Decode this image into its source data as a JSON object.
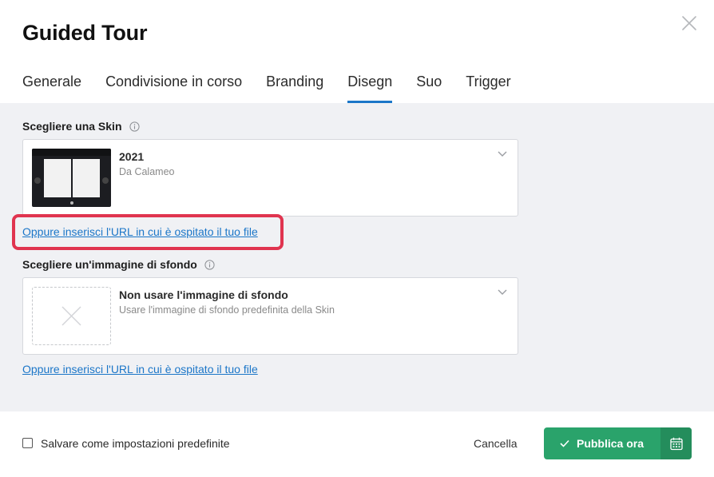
{
  "dialog": {
    "title": "Guided Tour"
  },
  "tabs": [
    {
      "label": "Generale",
      "active": false
    },
    {
      "label": "Condivisione in corso",
      "active": false
    },
    {
      "label": "Branding",
      "active": false
    },
    {
      "label": "Disegn",
      "active": true
    },
    {
      "label": "Suo",
      "active": false
    },
    {
      "label": "Trigger",
      "active": false
    }
  ],
  "skin": {
    "label": "Scegliere una Skin",
    "selected_title": "2021",
    "selected_subtitle": "Da Calameo",
    "url_link": "Oppure inserisci l'URL in cui è ospitato il tuo file"
  },
  "background": {
    "label": "Scegliere un'immagine di sfondo",
    "selected_title": "Non usare l'immagine di sfondo",
    "selected_subtitle": "Usare l'immagine di sfondo predefinita della Skin",
    "url_link": "Oppure inserisci l'URL in cui è ospitato il tuo file"
  },
  "footer": {
    "checkbox_label": "Salvare come impostazioni predefinite",
    "checkbox_checked": false,
    "cancel_label": "Cancella",
    "publish_label": "Pubblica ora"
  },
  "icons": {
    "close": "close-icon",
    "info": "info-icon",
    "chevron": "chevron-down-icon",
    "check": "check-icon",
    "calendar": "calendar-icon"
  },
  "colors": {
    "accent": "#1b76c8",
    "publish": "#2aa36b",
    "publish_dark": "#248d5c",
    "highlight": "#e0344f",
    "content_bg": "#f0f1f4"
  }
}
